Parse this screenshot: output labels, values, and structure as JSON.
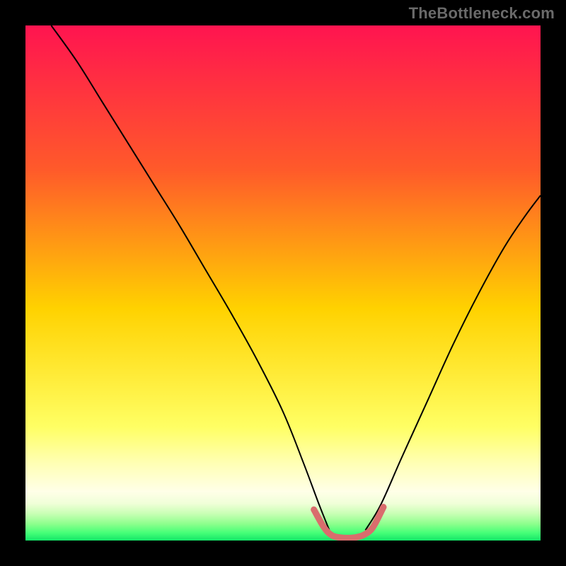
{
  "watermark": "TheBottleneck.com",
  "chart_data": {
    "type": "line",
    "title": "",
    "xlabel": "",
    "ylabel": "",
    "xlim": [
      0,
      100
    ],
    "ylim": [
      0,
      100
    ],
    "grid": false,
    "legend_position": "none",
    "note": "Gradient background with single V-shaped bottleneck curve; minimum ~x=59-66 near y=0. Values estimated from pixels.",
    "gradient_stops": [
      {
        "pos": 0.0,
        "color": "#ff1450"
      },
      {
        "pos": 0.28,
        "color": "#ff5a2a"
      },
      {
        "pos": 0.55,
        "color": "#ffd200"
      },
      {
        "pos": 0.78,
        "color": "#ffff64"
      },
      {
        "pos": 0.85,
        "color": "#ffffb4"
      },
      {
        "pos": 0.905,
        "color": "#ffffe8"
      },
      {
        "pos": 0.928,
        "color": "#f0ffd8"
      },
      {
        "pos": 0.948,
        "color": "#c8ffb4"
      },
      {
        "pos": 0.968,
        "color": "#8cff8c"
      },
      {
        "pos": 0.985,
        "color": "#46ff78"
      },
      {
        "pos": 1.0,
        "color": "#14e668"
      }
    ],
    "series": [
      {
        "name": "left-branch",
        "stroke": "#000000",
        "width": 2,
        "x": [
          5.0,
          10.0,
          15.0,
          20.0,
          25.0,
          30.0,
          35.0,
          40.0,
          45.0,
          50.0,
          54.0,
          57.0,
          59.0
        ],
        "y": [
          100.0,
          93.0,
          85.0,
          77.0,
          69.0,
          61.0,
          52.5,
          44.0,
          35.0,
          25.0,
          15.0,
          7.0,
          2.0
        ]
      },
      {
        "name": "right-branch",
        "stroke": "#000000",
        "width": 2,
        "x": [
          66.0,
          69.0,
          73.0,
          78.0,
          83.0,
          88.0,
          93.0,
          97.0,
          100.0
        ],
        "y": [
          2.0,
          7.0,
          16.0,
          27.0,
          38.0,
          48.0,
          57.0,
          63.0,
          67.0
        ]
      },
      {
        "name": "valley-marker",
        "stroke": "#d96d6d",
        "width": 9,
        "linecap": "round",
        "x": [
          56.0,
          58.0,
          59.5,
          61.0,
          62.5,
          64.0,
          65.5,
          67.0,
          68.0,
          69.5
        ],
        "y": [
          6.0,
          2.5,
          1.0,
          0.6,
          0.5,
          0.6,
          1.0,
          2.0,
          3.5,
          6.5
        ]
      }
    ]
  }
}
